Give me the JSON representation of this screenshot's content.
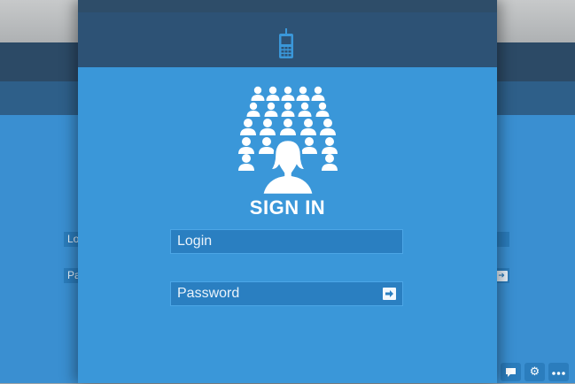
{
  "title": "SIGN IN",
  "login": {
    "placeholder": "Login"
  },
  "password": {
    "placeholder": "Password"
  },
  "background": {
    "login_fragment": "Lo",
    "password_fragment": "Pa"
  },
  "icons": {
    "header": "mobile-phone-icon",
    "avatar": "user-group-icon",
    "submit": "arrow-right-icon",
    "tools": [
      "chat-icon",
      "gear-icon",
      "more-icon"
    ]
  },
  "colors": {
    "panel": "#3a97d9",
    "header": "#2d5275",
    "field": "#2a7fc1",
    "text": "#ffffff"
  }
}
